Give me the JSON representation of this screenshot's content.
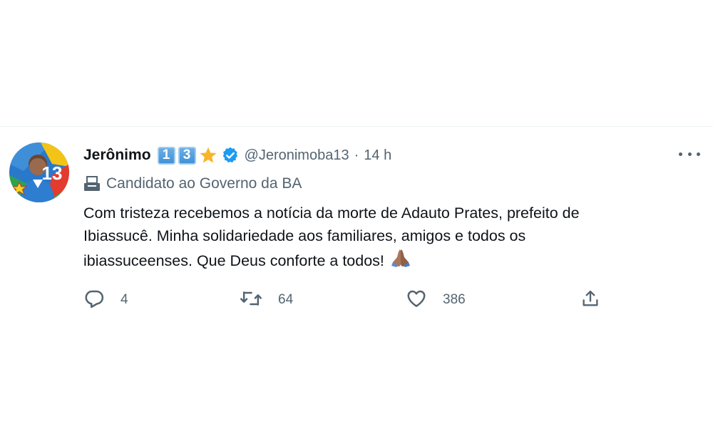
{
  "tweet": {
    "author_name": "Jerônimo",
    "badges": [
      "1",
      "3"
    ],
    "handle": "@Jeronimoba13",
    "separator": "·",
    "time": "14 h",
    "label": "Candidato ao Governo da BA",
    "text_lines": [
      "Com tristeza recebemos a notícia da morte de Adauto Prates, prefeito de",
      "Ibiassucê. Minha solidariedade aos familiares, amigos e todos os",
      "ibiassuceenses. Que Deus conforte a todos!"
    ],
    "avatar_number": "13",
    "icons": {
      "star": "star-emoji-icon",
      "verified": "verified-badge-icon",
      "more": "more-icon",
      "label": "ballot-box-icon",
      "pray": "folded-hands-emoji-icon"
    }
  },
  "actions": {
    "replies": "4",
    "retweets": "64",
    "likes": "386"
  },
  "colors": {
    "text": "#0f1419",
    "secondary": "#536471",
    "verified": "#1d9bf0",
    "divider": "#eff3f4"
  }
}
